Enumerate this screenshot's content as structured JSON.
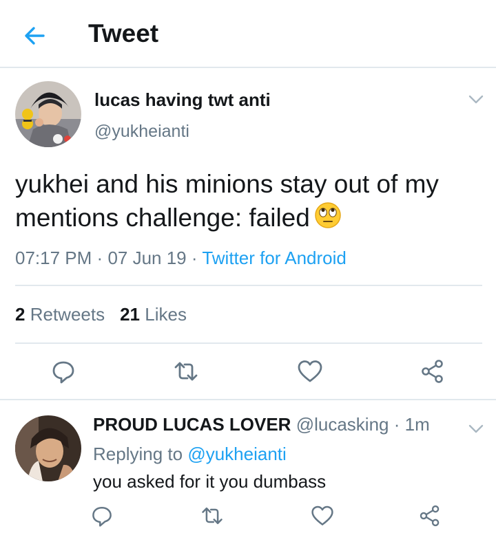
{
  "colors": {
    "accent": "#1da1f2",
    "secondary_text": "#657786",
    "primary_text": "#14171a",
    "divider": "#e1e8ed"
  },
  "header": {
    "title": "Tweet",
    "back_icon": "arrow-left-icon"
  },
  "tweet": {
    "display_name": "lucas having twt anti",
    "handle": "@yukheianti",
    "text": "yukhei and his minions stay out of my mentions challenge: failed",
    "emoji_icon": "face-with-rolling-eyes-icon",
    "time": "07:17 PM",
    "separator": "·",
    "date": "07 Jun 19",
    "source": "Twitter for Android",
    "retweets_count": "2",
    "retweets_label": "Retweets",
    "likes_count": "21",
    "likes_label": "Likes",
    "actions": [
      "reply-icon",
      "retweet-icon",
      "like-icon",
      "share-icon"
    ]
  },
  "reply": {
    "display_name": "PROUD LUCAS LOVER",
    "handle": "@lucasking",
    "separator": "·",
    "time": "1m",
    "replying_prefix": "Replying to",
    "replying_to": "@yukheianti",
    "text": "you asked for it you dumbass",
    "actions": [
      "reply-icon",
      "retweet-icon",
      "like-icon",
      "share-icon"
    ]
  }
}
